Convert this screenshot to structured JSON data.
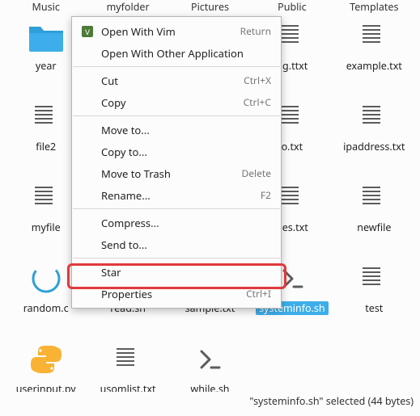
{
  "top_labels": [
    "Music",
    "myfolder",
    "Pictures",
    "Public",
    "Templates"
  ],
  "files": [
    {
      "name": "year",
      "icon": "folder",
      "selected": false
    },
    {
      "name": "",
      "icon": "none",
      "selected": false
    },
    {
      "name": "",
      "icon": "none",
      "selected": false
    },
    {
      "name": "fig.ttxt",
      "icon": "text",
      "selected": false
    },
    {
      "name": "example.txt",
      "icon": "text",
      "selected": false
    },
    {
      "name": "file2",
      "icon": "text",
      "selected": false
    },
    {
      "name": "",
      "icon": "none",
      "selected": false
    },
    {
      "name": "",
      "icon": "none",
      "selected": false
    },
    {
      "name": "o.txt",
      "icon": "text",
      "selected": false
    },
    {
      "name": "ipaddress.txt",
      "icon": "text",
      "selected": false
    },
    {
      "name": "myfile",
      "icon": "text",
      "selected": false
    },
    {
      "name": "",
      "icon": "none",
      "selected": false
    },
    {
      "name": "",
      "icon": "none",
      "selected": false
    },
    {
      "name": "nes.txt",
      "icon": "text",
      "selected": false
    },
    {
      "name": "newfile",
      "icon": "text",
      "selected": false
    },
    {
      "name": "random.c",
      "icon": "csrc",
      "selected": false
    },
    {
      "name": "read.sh",
      "icon": "shell",
      "selected": false
    },
    {
      "name": "sample.txt",
      "icon": "text",
      "selected": false
    },
    {
      "name": "systeminfo.sh",
      "icon": "shell",
      "selected": true
    },
    {
      "name": "test",
      "icon": "text",
      "selected": false
    },
    {
      "name": "userinput.py",
      "icon": "python",
      "selected": false
    },
    {
      "name": "usomlist.txt",
      "icon": "text",
      "selected": false
    },
    {
      "name": "while.sh",
      "icon": "shell",
      "selected": false
    }
  ],
  "context_menu": [
    {
      "type": "item",
      "label": "Open With Vim",
      "accel": "Return",
      "icon": "vim"
    },
    {
      "type": "item",
      "label": "Open With Other Application",
      "accel": "",
      "icon": ""
    },
    {
      "type": "sep"
    },
    {
      "type": "item",
      "label": "Cut",
      "accel": "Ctrl+X",
      "icon": ""
    },
    {
      "type": "item",
      "label": "Copy",
      "accel": "Ctrl+C",
      "icon": ""
    },
    {
      "type": "sep"
    },
    {
      "type": "item",
      "label": "Move to...",
      "accel": "",
      "icon": ""
    },
    {
      "type": "item",
      "label": "Copy to...",
      "accel": "",
      "icon": ""
    },
    {
      "type": "item",
      "label": "Move to Trash",
      "accel": "Delete",
      "icon": ""
    },
    {
      "type": "item",
      "label": "Rename...",
      "accel": "F2",
      "icon": ""
    },
    {
      "type": "sep"
    },
    {
      "type": "item",
      "label": "Compress...",
      "accel": "",
      "icon": ""
    },
    {
      "type": "item",
      "label": "Send to...",
      "accel": "",
      "icon": ""
    },
    {
      "type": "sep"
    },
    {
      "type": "item",
      "label": "Star",
      "accel": "",
      "icon": ""
    },
    {
      "type": "item",
      "label": "Properties",
      "accel": "Ctrl+I",
      "icon": ""
    }
  ],
  "status_text": "\"systeminfo.sh\" selected  (44 bytes)"
}
